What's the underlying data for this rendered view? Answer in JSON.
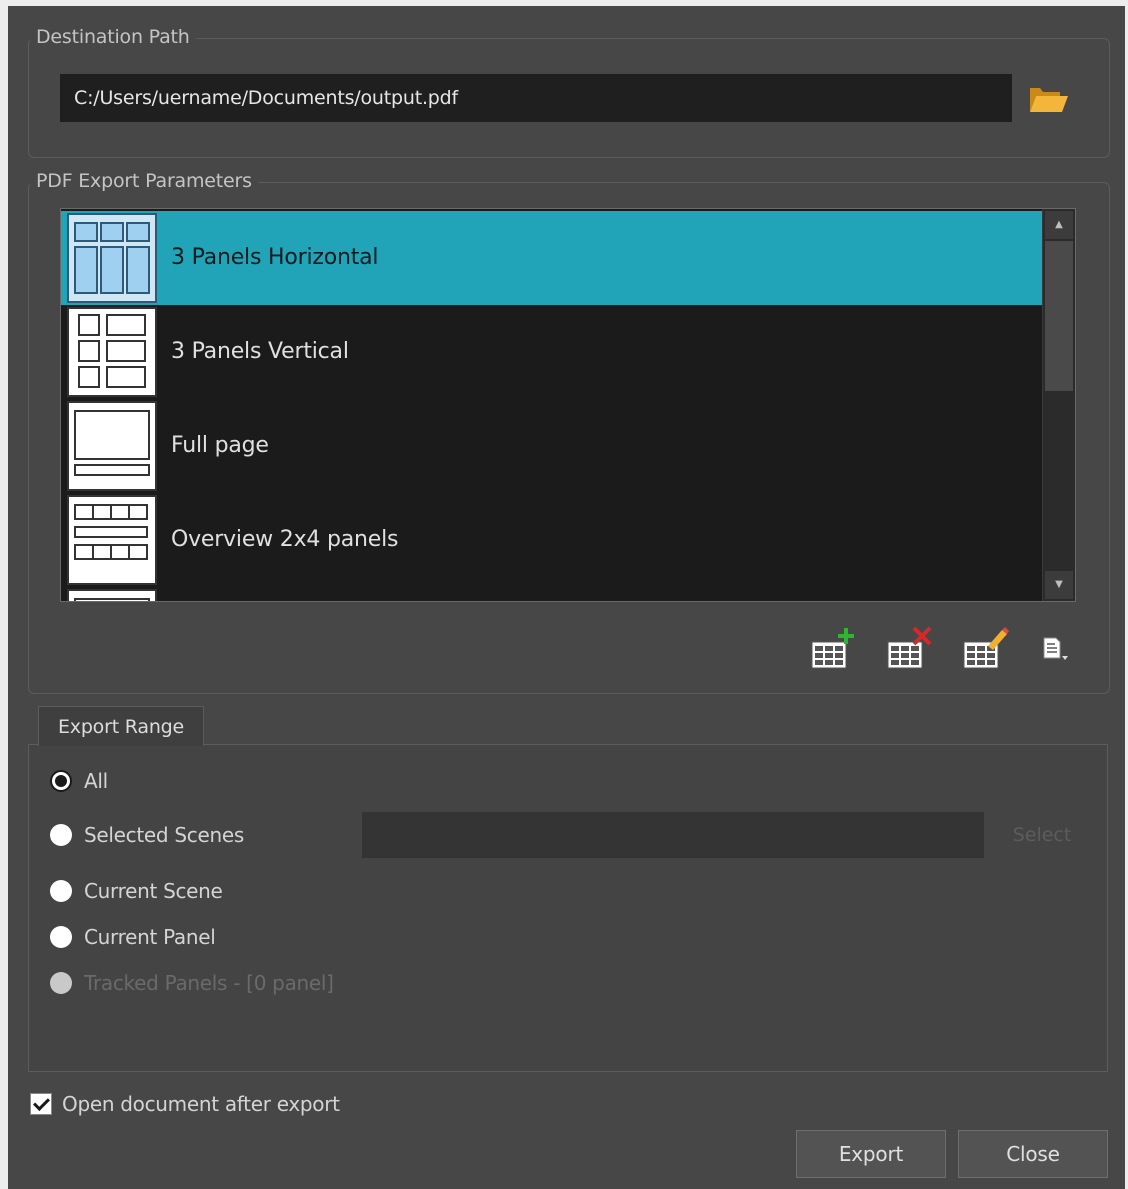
{
  "destination": {
    "title": "Destination Path",
    "path_value": "C:/Users/uername/Documents/output.pdf",
    "browse_icon": "folder-open-icon"
  },
  "pdf_params": {
    "title": "PDF Export Parameters",
    "items": [
      {
        "label": "3 Panels Horizontal",
        "selected": true
      },
      {
        "label": "3 Panels Vertical",
        "selected": false
      },
      {
        "label": "Full page",
        "selected": false
      },
      {
        "label": "Overview 2x4 panels",
        "selected": false
      }
    ],
    "tools": [
      "add-profile-icon",
      "delete-profile-icon",
      "edit-profile-icon",
      "profile-menu-icon"
    ]
  },
  "export_range": {
    "tab_label": "Export Range",
    "options": [
      {
        "label": "All",
        "checked": true,
        "enabled": true
      },
      {
        "label": "Selected Scenes",
        "checked": false,
        "enabled": true
      },
      {
        "label": "Current Scene",
        "checked": false,
        "enabled": true
      },
      {
        "label": "Current Panel",
        "checked": false,
        "enabled": true
      },
      {
        "label": "Tracked Panels - [0 panel]",
        "checked": false,
        "enabled": false
      }
    ],
    "select_label": "Select"
  },
  "open_after_export": {
    "label": "Open document after export",
    "checked": true
  },
  "buttons": {
    "export": "Export",
    "close": "Close"
  },
  "colors": {
    "selection": "#21a3b8",
    "background": "#474747",
    "list_bg": "#1b1b1b"
  }
}
